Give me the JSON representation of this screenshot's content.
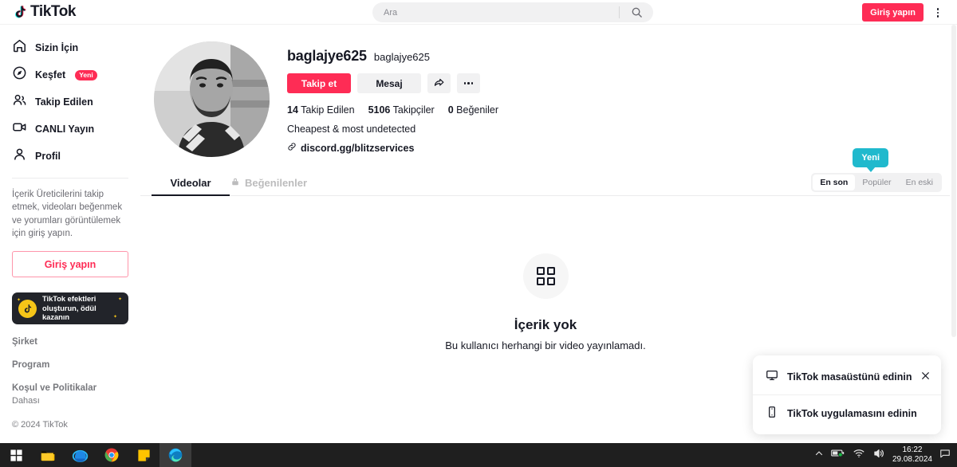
{
  "header": {
    "logo_text": "TikTok",
    "search_placeholder": "Ara",
    "search_value": "",
    "login_label": "Giriş yapın"
  },
  "sidebar": {
    "items": [
      {
        "label": "Sizin İçin",
        "icon": "home-icon",
        "badge": ""
      },
      {
        "label": "Keşfet",
        "icon": "compass-icon",
        "badge": "Yeni"
      },
      {
        "label": "Takip Edilen",
        "icon": "people-icon",
        "badge": ""
      },
      {
        "label": "CANLI Yayın",
        "icon": "live-icon",
        "badge": ""
      },
      {
        "label": "Profil",
        "icon": "person-icon",
        "badge": ""
      }
    ],
    "login_prompt": "İçerik Üreticilerini takip etmek, videoları beğenmek ve yorumları görüntülemek için giriş yapın.",
    "login_label": "Giriş yapın",
    "promo_text": "TikTok efektleri oluşturun, ödül kazanın",
    "footer": [
      {
        "label": "Şirket",
        "sub": false
      },
      {
        "label": "Program",
        "sub": false
      },
      {
        "label": "Koşul ve Politikalar",
        "sub": false
      },
      {
        "label": "Dahası",
        "sub": true
      }
    ],
    "copyright": "© 2024 TikTok"
  },
  "profile": {
    "username": "baglajye625",
    "nickname": "baglajye625",
    "follow_label": "Takip et",
    "message_label": "Mesaj",
    "stats": [
      {
        "num": "14",
        "label": "Takip Edilen"
      },
      {
        "num": "5106",
        "label": "Takipçiler"
      },
      {
        "num": "0",
        "label": "Beğeniler"
      }
    ],
    "bio": "Cheapest & most undetected",
    "link": "discord.gg/blitzservices"
  },
  "tabs": [
    {
      "label": "Videolar",
      "active": true,
      "locked": false
    },
    {
      "label": "Beğenilenler",
      "active": false,
      "locked": true
    }
  ],
  "sort": {
    "tooltip": "Yeni",
    "options": [
      {
        "label": "En son",
        "active": true
      },
      {
        "label": "Popüler",
        "active": false
      },
      {
        "label": "En eski",
        "active": false
      }
    ]
  },
  "empty_state": {
    "title": "İçerik yok",
    "subtitle": "Bu kullanıcı herhangi bir video yayınlamadı."
  },
  "popup": {
    "desktop_label": "TikTok masaüstünü edinin",
    "app_label": "TikTok uygulamasını edinin"
  },
  "taskbar": {
    "time": "16:22",
    "date": "29.08.2024"
  },
  "colors": {
    "accent_red": "#fe2c55",
    "tooltip_teal": "#20b9cd",
    "text_dark": "#161823"
  }
}
